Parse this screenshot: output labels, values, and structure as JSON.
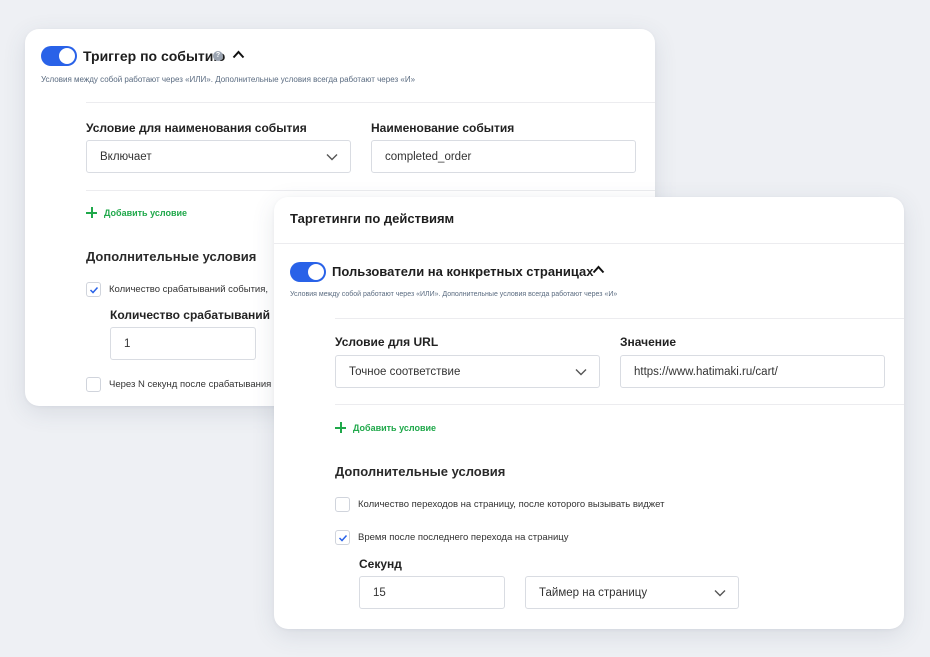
{
  "back_card": {
    "trigger_title": "Триггер по событию",
    "help_glyph": "?",
    "hint": "Условия между собой работают через «ИЛИ». Дополнительные условия всегда работают через «И»",
    "condition_label": "Условие для наименования события",
    "condition_value": "Включает",
    "name_label": "Наименование события",
    "name_value": "completed_order",
    "add_condition": "Добавить условие",
    "extra_title": "Дополнительные условия",
    "cb1_label": "Количество срабатываний события,",
    "cb1_checked": true,
    "count_label": "Количество срабатываний",
    "count_value": "1",
    "cb2_label": "Через N секунд после срабатывания",
    "cb2_checked": false
  },
  "front_card": {
    "header": "Таргетинги по действиям",
    "users_title": "Пользователи на конкретных страницах",
    "hint": "Условия между собой работают через «ИЛИ». Дополнительные условия всегда работают через «И»",
    "url_label": "Условие для URL",
    "url_condition_value": "Точное соответствие",
    "value_label": "Значение",
    "value_value": "https://www.hatimaki.ru/cart/",
    "add_condition": "Добавить условие",
    "extra_title": "Дополнительные условия",
    "cb1_label": "Количество переходов на страницу, после которого вызывать виджет",
    "cb1_checked": false,
    "cb2_label": "Время после последнего перехода на страницу",
    "cb2_checked": true,
    "seconds_label": "Секунд",
    "seconds_value": "15",
    "timer_value": "Таймер на страницу"
  },
  "colors": {
    "toggle": "#2962e8",
    "add_green": "#1fa84a",
    "check_blue": "#2962e8",
    "background": "#eef0f4"
  },
  "icons": [
    "toggle-switch",
    "help-icon",
    "chevron-up-icon",
    "chevron-down-icon",
    "plus-icon",
    "check-icon"
  ]
}
